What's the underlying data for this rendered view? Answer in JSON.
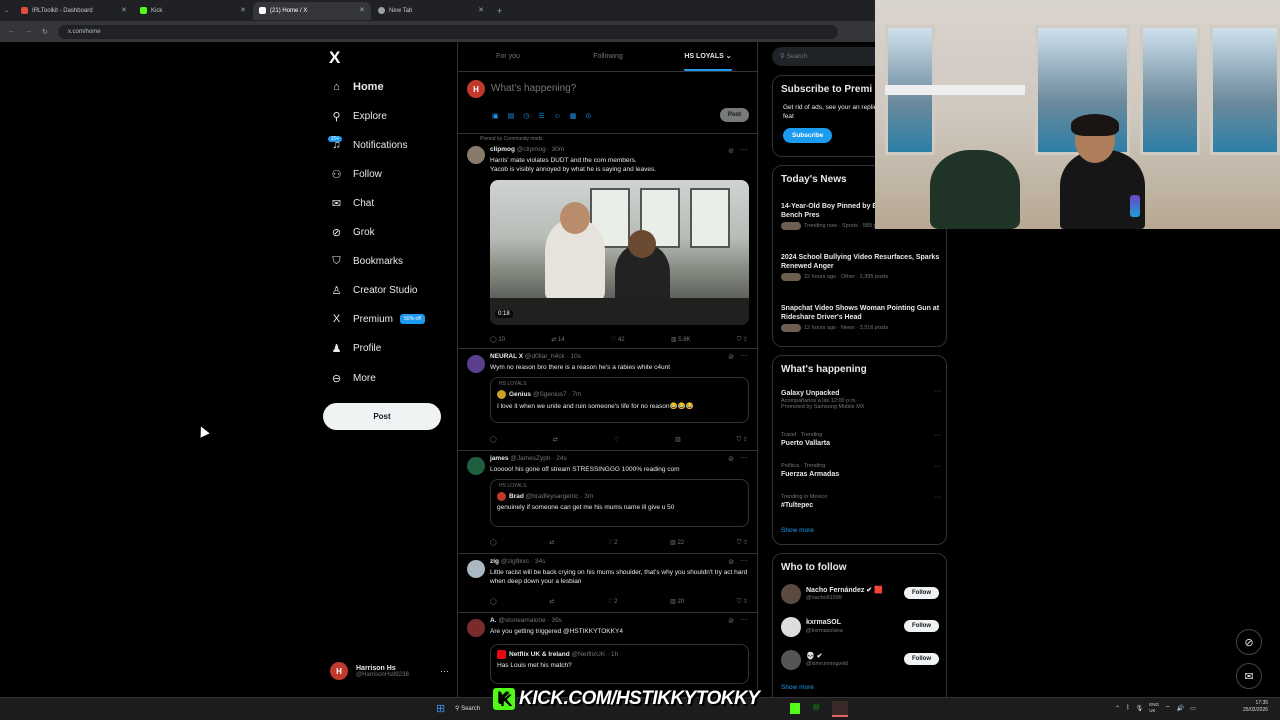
{
  "browser": {
    "tabs": [
      {
        "label": "IRLToolkit - Dashboard",
        "color": "#e74c3c"
      },
      {
        "label": "Kick",
        "color": "#53fc18"
      },
      {
        "label": "(21) Home / X",
        "color": "#ffffff"
      },
      {
        "label": "New Tab",
        "color": "#9aa0a6"
      }
    ],
    "url": "x.com/home"
  },
  "nav": {
    "logo": "X",
    "items": [
      {
        "label": "Home",
        "icon": "⌂"
      },
      {
        "label": "Explore",
        "icon": "⚲"
      },
      {
        "label": "Notifications",
        "icon": "♫"
      },
      {
        "label": "Follow",
        "icon": "⚇"
      },
      {
        "label": "Chat",
        "icon": "✉"
      },
      {
        "label": "Grok",
        "icon": "⊘"
      },
      {
        "label": "Bookmarks",
        "icon": "⛉"
      },
      {
        "label": "Creator Studio",
        "icon": "♙"
      },
      {
        "label": "Premium",
        "icon": "X"
      },
      {
        "label": "Profile",
        "icon": "♟"
      },
      {
        "label": "More",
        "icon": "⊖"
      }
    ],
    "notif_count": "20+",
    "premium_badge": "50% off",
    "post": "Post",
    "profile": {
      "name": "Harrison Hs",
      "handle": "@HarrisonHs89238",
      "initial": "H",
      "more": "···"
    }
  },
  "timeline": {
    "tabs": [
      "For you",
      "Following",
      "HS LOYALS ⌄"
    ],
    "composer": {
      "initial": "H",
      "placeholder": "What's happening?",
      "tools": "▣▤◷☰☺▦⊙",
      "post": "Post"
    },
    "tweets": [
      {
        "pinned": "Pinned by Community mods",
        "name": "clipmog",
        "handle": "@clipmog · 30m",
        "text": "Harris' mate violates DUDT and the com members.\nYacob is visibly annoyed by what he is saying and leaves.",
        "duration": "0:18",
        "replies": "10",
        "reposts": "14",
        "likes": "42",
        "views": "5.8K"
      },
      {
        "name": "NEURAL X",
        "handle": "@d0llar_h4ck · 10s",
        "text": "Wym no reason bro there is a reason he's a rabies white c4unt",
        "quote": {
          "community": "HS LOYALS",
          "name": "Genius",
          "handle": "@Sgenius7 · 7m",
          "text": "I love it when we unite and ruin someone's life for no reason😂😂😂"
        }
      },
      {
        "name": "james",
        "handle": "@JamesZyph · 24s",
        "text": "Looooo! his gone off stream STRESSINGGG 1000% reading com",
        "quote": {
          "community": "HS LOYALS",
          "name": "Brad",
          "handle": "@bradleysargentc · 3m",
          "text": "genuinely if someone can get me his mums name ill give u 50"
        },
        "likes": "2",
        "views": "22"
      },
      {
        "name": "zig",
        "handle": "@zig9kxc · 34s",
        "text": "Little racist will be back crying on his mums  shoulder, that's why you shouldn't try act hard when deep down your a lesbian",
        "likes": "2",
        "views": "20"
      },
      {
        "name": "A.",
        "handle": "@stoneamalone · 39s",
        "text": "Are you getting triggered @HSTIKKYTOKKY4",
        "quote": {
          "name": "Netflix UK & Ireland",
          "handle": "@NetflixUK · 1h",
          "text": "Has Louis met his match?"
        }
      }
    ]
  },
  "sidebar": {
    "search": "Search",
    "subscribe": {
      "title": "Subscribe to Premi",
      "desc": "Get rid of ads, see your an replies and unlock 20+ feat",
      "button": "Subscribe"
    },
    "news": {
      "title": "Today's News",
      "items": [
        {
          "title": "14-Year-Old Boy Pinned by Barbell During Bench Pres",
          "meta": "Trending now · Sports · 589 posts"
        },
        {
          "title": "2024 School Bullying Video Resurfaces, Sparks Renewed Anger",
          "meta": "22 hours ago · Other · 2,395 posts"
        },
        {
          "title": "Snapchat Video Shows Woman Pointing Gun at Rideshare Driver's Head",
          "meta": "12 hours ago · News · 3,516 posts"
        }
      ]
    },
    "happening": {
      "title": "What's happening",
      "items": [
        {
          "cat": "",
          "name": "Galaxy Unpacked",
          "sub": "Acompáñanos a las 12:00 p.m.\nPromoted by Samsung Mobile MX"
        },
        {
          "cat": "Travel · Trending",
          "name": "Puerto Vallarta",
          "sub": ""
        },
        {
          "cat": "Política · Trending",
          "name": "Fuerzas Armadas",
          "sub": ""
        },
        {
          "cat": "Trending in Mexico",
          "name": "#Tultepec",
          "sub": ""
        }
      ],
      "show_more": "Show more",
      "more": "···"
    },
    "who": {
      "title": "Who to follow",
      "items": [
        {
          "name": "Nacho Fernández ✔ 🟥",
          "handle": "@nacho81999",
          "button": "Follow"
        },
        {
          "name": "kxrmaSOL",
          "handle": "@kxrmasolana",
          "button": "Follow"
        },
        {
          "name": "💀 ✔",
          "handle": "@ismrunningwild",
          "button": "Follow"
        }
      ],
      "show_more": "Show more"
    }
  },
  "overlay": {
    "kick_url": "KICK.COM/HSTIKKYTOKKY",
    "kick_logo": "K"
  },
  "taskbar": {
    "search": "Search",
    "lang": "ENG\nUK",
    "time": "17:35",
    "date": "25/02/2026"
  }
}
